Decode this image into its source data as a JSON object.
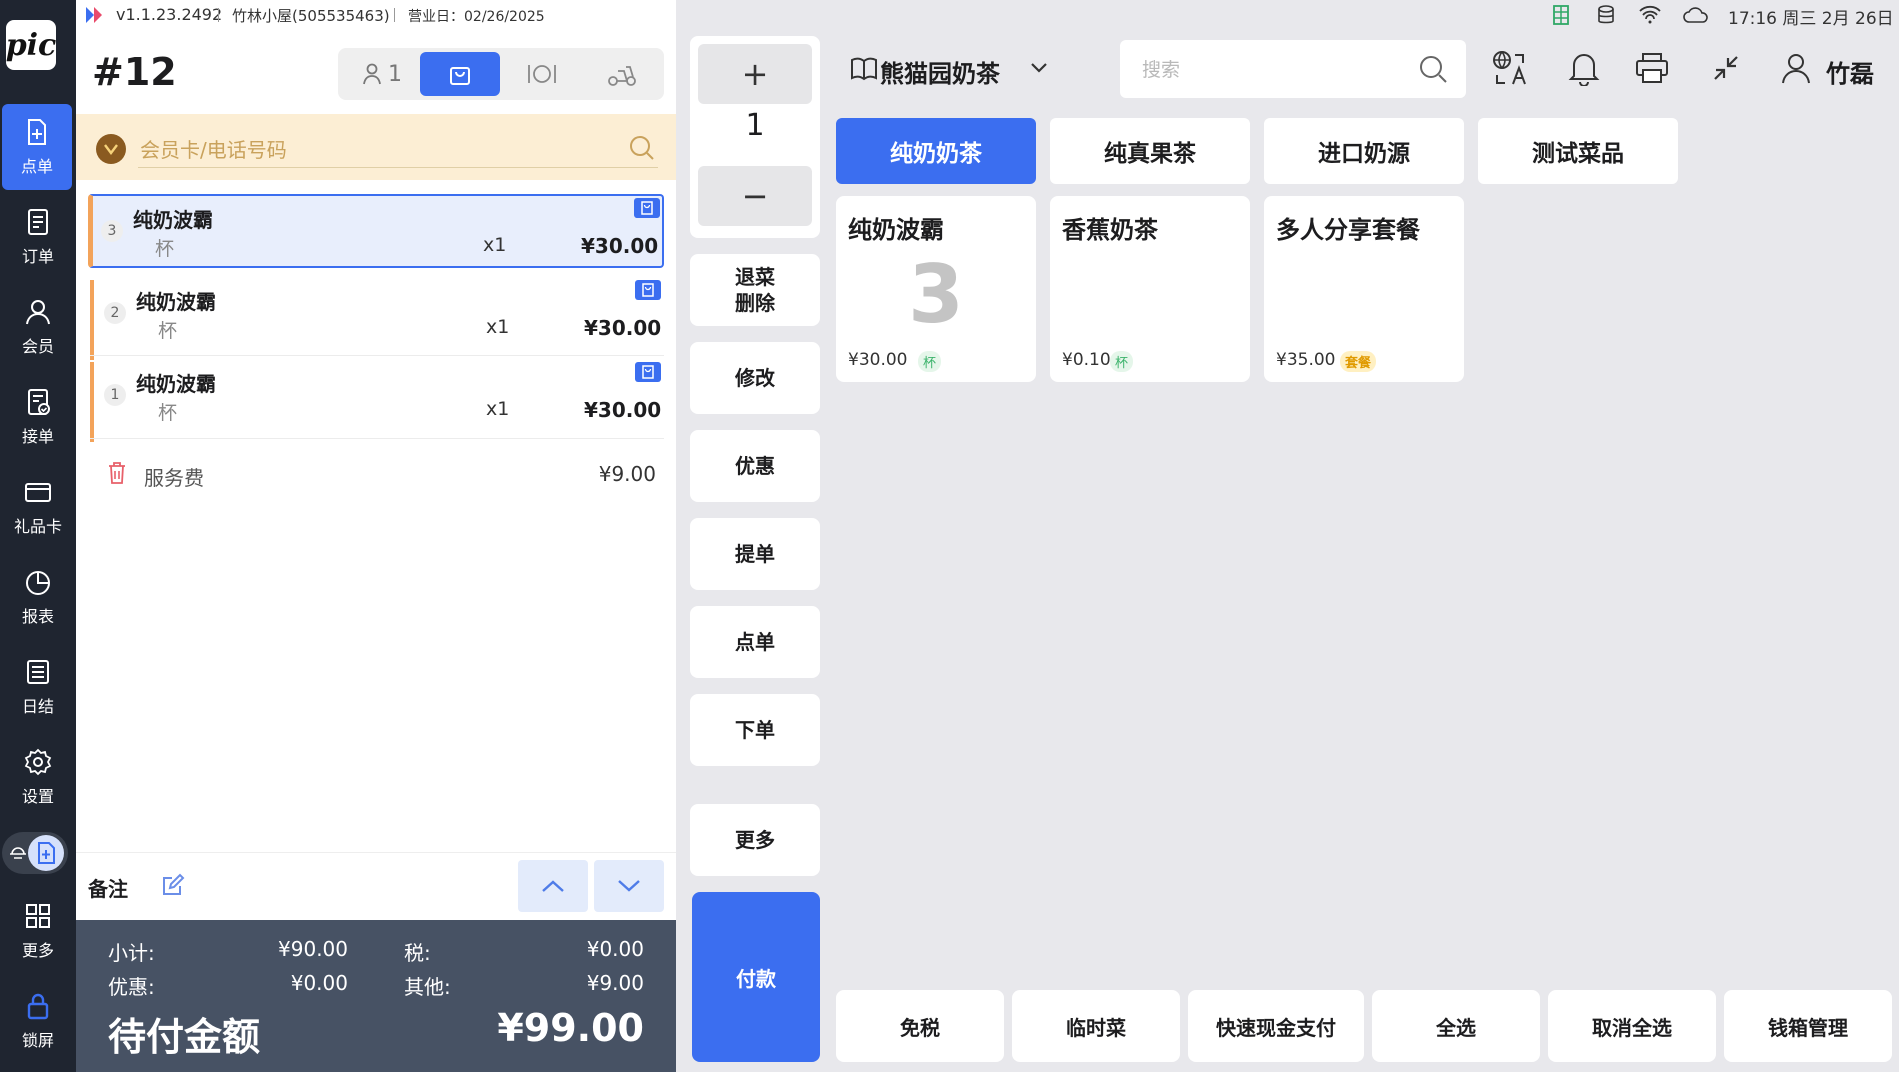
{
  "status_bar": {
    "version": "v1.1.23.2492",
    "store": "竹林小屋(505535463)",
    "business_day": "营业日：02/26/2025",
    "clock": "17:16 周三 2月 26日"
  },
  "sidebar": {
    "logo": "pic",
    "items": [
      {
        "label": "点单",
        "icon": "order-add-icon"
      },
      {
        "label": "订单",
        "icon": "orders-icon"
      },
      {
        "label": "会员",
        "icon": "member-icon"
      },
      {
        "label": "接单",
        "icon": "accept-order-icon"
      },
      {
        "label": "礼品卡",
        "icon": "gift-card-icon"
      },
      {
        "label": "报表",
        "icon": "report-icon"
      },
      {
        "label": "日结",
        "icon": "daily-close-icon"
      },
      {
        "label": "设置",
        "icon": "gear-icon"
      },
      {
        "label": "更多",
        "icon": "grid-icon"
      },
      {
        "label": "锁屏",
        "icon": "lock-icon"
      }
    ]
  },
  "order": {
    "number": "#12",
    "guests": "1",
    "member_placeholder": "会员卡/电话号码",
    "items": [
      {
        "seq": "3",
        "name": "纯奶波霸",
        "unit": "杯",
        "qty": "x1",
        "price": "¥30.00"
      },
      {
        "seq": "2",
        "name": "纯奶波霸",
        "unit": "杯",
        "qty": "x1",
        "price": "¥30.00"
      },
      {
        "seq": "1",
        "name": "纯奶波霸",
        "unit": "杯",
        "qty": "x1",
        "price": "¥30.00"
      }
    ],
    "service_fee_label": "服务费",
    "service_fee": "¥9.00",
    "remark_label": "备注",
    "totals": {
      "subtotal_label": "小计:",
      "subtotal": "¥90.00",
      "tax_label": "税:",
      "tax": "¥0.00",
      "discount_label": "优惠:",
      "discount": "¥0.00",
      "other_label": "其他:",
      "other": "¥9.00",
      "due_label": "待付金额",
      "due": "¥99.00"
    }
  },
  "actions": {
    "plus": "+",
    "qty": "1",
    "minus": "−",
    "void_line1": "退菜",
    "void_line2": "删除",
    "modify": "修改",
    "discount": "优惠",
    "takeout": "提单",
    "order": "点单",
    "place_order": "下单",
    "more": "更多",
    "pay": "付款"
  },
  "catalog": {
    "store_name": "熊猫园奶茶",
    "search_placeholder": "搜索",
    "user": "竹磊",
    "categories": [
      "纯奶奶茶",
      "纯真果茶",
      "进口奶源",
      "测试菜品"
    ],
    "products": [
      {
        "name": "纯奶波霸",
        "count": "3",
        "price": "¥30.00",
        "badge": "杯"
      },
      {
        "name": "香蕉奶茶",
        "count": "",
        "price": "¥0.10",
        "badge": "杯"
      },
      {
        "name": "多人分享套餐",
        "count": "",
        "price": "¥35.00",
        "badge": "套餐"
      }
    ],
    "footer": [
      "免税",
      "临时菜",
      "快速现金支付",
      "全选",
      "取消全选",
      "钱箱管理"
    ]
  },
  "colors": {
    "accent": "#3b6ef0",
    "sidebar": "#1f2530",
    "totals_bg": "#475264",
    "member_bar": "#fceed4",
    "item_stripe": "#f3a35a"
  }
}
